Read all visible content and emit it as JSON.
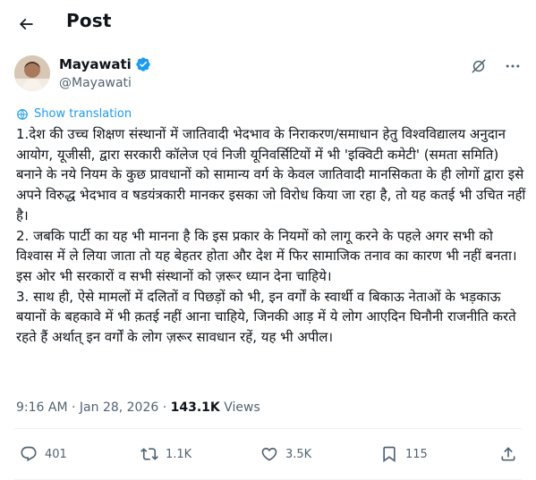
{
  "header": {
    "title": "Post",
    "back_icon": "arrow-left-icon"
  },
  "author": {
    "display_name": "Mayawati",
    "handle": "@Mayawati",
    "verified_badge_color": "#1d9bf0",
    "avatar": "avatar-photo"
  },
  "top_icons": [
    "grok-slash-icon",
    "more-horizontal-icon"
  ],
  "translation": {
    "label": "Show translation",
    "icon": "globe-icon",
    "color": "#1d9bf0"
  },
  "post": {
    "paragraphs": [
      "1.देश की उच्च शिक्षण संस्थानों में जातिवादी भेदभाव के निराकरण/समाधान हेतु विश्वविद्यालय अनुदान आयोग, यूजीसी, द्वारा सरकारी कॉलेज एवं निजी यूनिवर्सिटियों में भी 'इक्विटी कमेटी' (समता समिति) बनाने के नये नियम के कुछ प्रावधानों को सामान्य वर्ग के केवल जातिवादी मानसिकता के ही लोगों द्वारा इसे अपने विरुद्ध भेदभाव व षडयंत्रकारी मानकर इसका जो विरोध किया जा रहा है, तो यह कतई भी उचित नहीं है।",
      "2. जबकि पार्टी का यह भी मानना है कि इस प्रकार के नियमों को लागू करने के पहले अगर सभी को विश्वास में ले लिया जाता तो यह बेहतर होता और देश में फिर सामाजिक तनाव का कारण भी नहीं बनता। इस ओर भी सरकारों व सभी संस्थानों को ज़रूर ध्यान देना चाहिये।",
      "3. साथ ही, ऐसे मामलों में दलितों व पिछड़ों को भी, इन वर्गों के स्वार्थी व बिकाऊ नेताओं के भड़काऊ बयानों के बहकावे में भी क़तई नहीं आना चाहिये, जिनकी आड़ में ये लोग आएदिन घिनौनी राजनीति करते रहते हैं अर्थात् इन वर्गों के लोग ज़रूर सावधान रहें, यह भी अपील।"
    ]
  },
  "meta": {
    "time": "9:16 AM",
    "separator": "·",
    "date": "Jan 28, 2026",
    "views_count": "143.1K",
    "views_label": "Views"
  },
  "actions": {
    "replies": {
      "icon": "reply-icon",
      "count": "401"
    },
    "reposts": {
      "icon": "repost-icon",
      "count": "1.1K"
    },
    "likes": {
      "icon": "heart-icon",
      "count": "3.5K"
    },
    "bookmarks": {
      "icon": "bookmark-icon",
      "count": "115"
    },
    "share": {
      "icon": "share-icon"
    }
  },
  "colors": {
    "text": "#0f1419",
    "secondary": "#536471",
    "accent": "#1d9bf0",
    "divider": "#eff3f4"
  }
}
